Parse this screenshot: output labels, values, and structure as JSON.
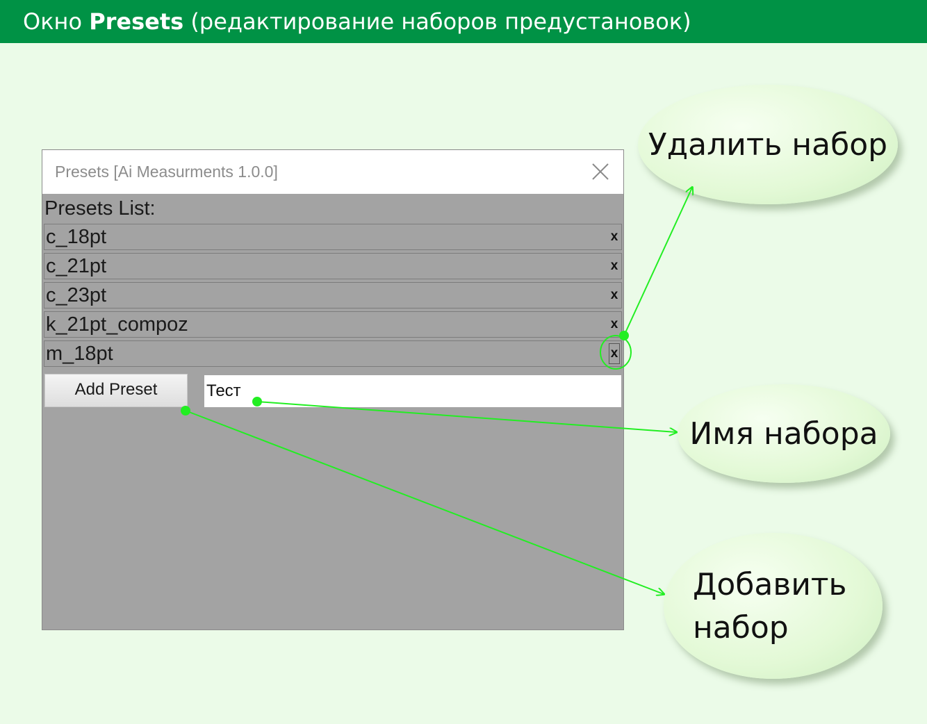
{
  "header": {
    "prefix": "Окно ",
    "bold": "Presets",
    "suffix": " (редактирование наборов предустановок)"
  },
  "dialog": {
    "title": "Presets [Ai Measurments 1.0.0]",
    "close_icon": "close-icon",
    "list_label": "Presets List:",
    "presets": [
      {
        "name": "c_18pt",
        "delete": "x"
      },
      {
        "name": "c_21pt",
        "delete": "x"
      },
      {
        "name": "c_23pt",
        "delete": "x"
      },
      {
        "name": "k_21pt_compoz",
        "delete": "x"
      },
      {
        "name": "m_18pt",
        "delete": "x"
      }
    ],
    "add_button_label": "Add Preset",
    "name_input_value": "Тест"
  },
  "callouts": {
    "delete_set": "Удалить набор",
    "set_name": "Имя набора",
    "add_set_line1": "Добавить",
    "add_set_line2": "набор"
  },
  "colors": {
    "header_bg": "#009245",
    "page_bg": "#ebfbe8",
    "dialog_bg": "#a3a3a3",
    "annotation_line": "#22ee22"
  }
}
